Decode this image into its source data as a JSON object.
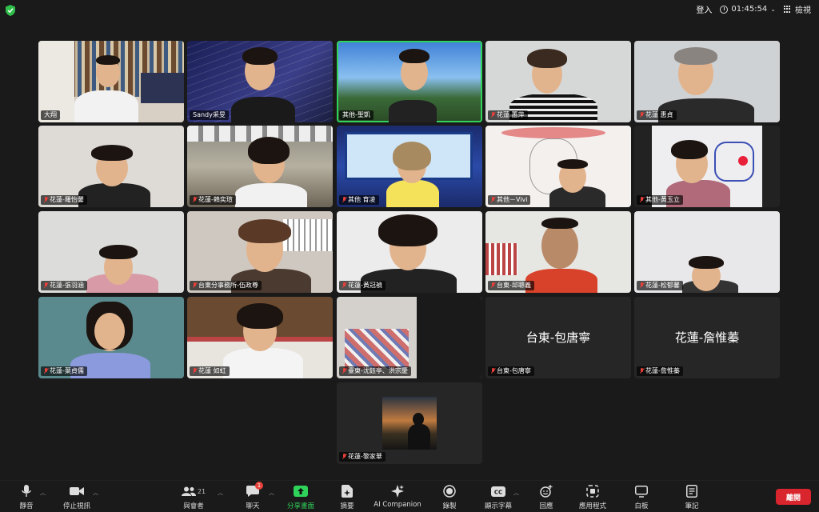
{
  "topbar": {
    "login": "登入",
    "timer": "01:45:54",
    "view": "檢視"
  },
  "tiles": [
    {
      "name": "大翔",
      "muted": false
    },
    {
      "name": "Sandy采旻",
      "muted": false
    },
    {
      "name": "其他-聖凱",
      "muted": false
    },
    {
      "name": "花蓮 蕙萍",
      "muted": true
    },
    {
      "name": "花蓮 惠貞",
      "muted": true
    },
    {
      "name": "花蓮-羅怡馨",
      "muted": true
    },
    {
      "name": "花蓮-賴奕瑄",
      "muted": true
    },
    {
      "name": "其他 育凌",
      "muted": true
    },
    {
      "name": "其他－Vivi",
      "muted": true
    },
    {
      "name": "其他-黃玉立",
      "muted": true
    },
    {
      "name": "花蓮-張羽涵",
      "muted": true
    },
    {
      "name": "台東分事務所-伍政尊",
      "muted": true
    },
    {
      "name": "花蓮-黃冠禎",
      "muted": true
    },
    {
      "name": "台東-邱聰義",
      "muted": true
    },
    {
      "name": "花蓮-松郁馨",
      "muted": true
    },
    {
      "name": "花蓮-葉貞儒",
      "muted": true
    },
    {
      "name": "花蓮 如虹",
      "muted": true
    },
    {
      "name": "臺東-沈鈺亭、洪宗慶",
      "muted": true
    },
    {
      "name": "台東-包唐寧",
      "muted": true,
      "display_name": "台東-包唐寧"
    },
    {
      "name": "花蓮-詹惟蓁",
      "muted": true,
      "display_name": "花蓮-詹惟蓁"
    },
    {
      "name": "花蓮-黎家華",
      "muted": true
    }
  ],
  "toolbar": {
    "mute": "靜音",
    "video": "停止視訊",
    "participants": "與會者",
    "participants_count": "21",
    "chat": "聊天",
    "chat_badge": "1",
    "share": "分享畫面",
    "summary": "摘要",
    "ai": "AI Companion",
    "record": "錄製",
    "captions": "顯示字幕",
    "reactions": "回應",
    "apps": "應用程式",
    "whiteboard": "白板",
    "notes": "筆記",
    "leave": "離開"
  }
}
